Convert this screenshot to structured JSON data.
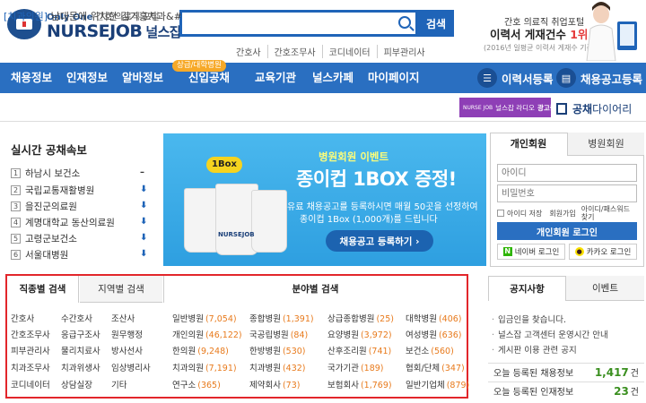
{
  "header": {
    "tagline_bold": "Only One",
    "tagline": "간호/의료직 포털",
    "brand": "NURSEJOB",
    "brand_kr": "널스잡",
    "search_placeholder": "",
    "search_button": "검색",
    "quick_links": [
      "간호사",
      "간호조무사",
      "코디네이터",
      "피부관리사"
    ],
    "ad_line1": "간호 의료직 취업포털",
    "ad_line2_prefix": "이력서 게재건수",
    "ad_line2_highlight": "1위",
    "ad_line3": "(2016년 일평균 이력서 게재수 기준)"
  },
  "nav": {
    "items": [
      "채용정보",
      "인재정보",
      "알바정보",
      "신입공채",
      "교육기관",
      "널스카페",
      "마이페이지"
    ],
    "badge": "상급/대학병원",
    "resume_button": "이력서등록",
    "job_post_button": "채용공고등록"
  },
  "notice_bar": {
    "tag": "[치과의원]",
    "text": "남대문에 위치한 김기홍치과&#",
    "radio_ad_small": "NURSE JOB",
    "radio_ad": "널스잡 라디오",
    "radio_ad_bold": "광고중",
    "diary_bold": "공채",
    "diary_rest": "다이어리"
  },
  "realtime": {
    "title": "실시간 공채속보",
    "items": [
      {
        "num": "1",
        "name": "하남시 보건소",
        "trend": "–"
      },
      {
        "num": "2",
        "name": "국립교통재활병원",
        "trend": "⬇"
      },
      {
        "num": "3",
        "name": "을진군의료원",
        "trend": "⬇"
      },
      {
        "num": "4",
        "name": "계명대학교 동산의료원",
        "trend": "⬇"
      },
      {
        "num": "5",
        "name": "고령군보건소",
        "trend": "⬇"
      },
      {
        "num": "6",
        "name": "서울대병원",
        "trend": "⬇"
      }
    ]
  },
  "banner": {
    "pill": "1Box",
    "cup_label": "NURSEJOB",
    "sub": "병원회원 이벤트",
    "main": "종이컵 1BOX 증정!",
    "desc1": "유료 채용공고를 등록하시면 매월 50곳을 선정하여",
    "desc2": "종이컵 1Box (1,000개)를 드립니다",
    "button": "채용공고 등록하기 ›"
  },
  "login": {
    "tab_personal": "개인회원",
    "tab_hospital": "병원회원",
    "id_placeholder": "아이디",
    "pw_placeholder": "비밀번호",
    "save_id": "아이디 저장",
    "join": "회원가입",
    "find": "아이디/패스워드",
    "find2": "찾기",
    "login_button": "개인회원 로그인",
    "naver": "네이버 로그인",
    "kakao": "카카오 로그인"
  },
  "categories": {
    "tab_job": "직종별 검색",
    "tab_region": "지역별 검색",
    "tab_field": "분야별 검색",
    "job_cols": [
      [
        "간호사",
        "간호조무사",
        "피부관리사",
        "치과조무사",
        "코디네이터"
      ],
      [
        "수간호사",
        "응급구조사",
        "물리치료사",
        "치과위생사",
        "상담실장"
      ],
      [
        "조산사",
        "원무행정",
        "방사선사",
        "임상병리사",
        "기타"
      ]
    ],
    "field_cols": [
      [
        [
          "일반병원",
          "(7,054)"
        ],
        [
          "개인의원",
          "(46,122)"
        ],
        [
          "한의원",
          "(9,248)"
        ],
        [
          "치과의원",
          "(7,191)"
        ],
        [
          "연구소",
          "(365)"
        ]
      ],
      [
        [
          "종합병원",
          "(1,391)"
        ],
        [
          "국공립병원",
          "(84)"
        ],
        [
          "한방병원",
          "(530)"
        ],
        [
          "치과병원",
          "(432)"
        ],
        [
          "제약회사",
          "(73)"
        ]
      ],
      [
        [
          "상급종합병원",
          "(25)"
        ],
        [
          "요양병원",
          "(3,972)"
        ],
        [
          "산후조리원",
          "(741)"
        ],
        [
          "국가기관",
          "(189)"
        ],
        [
          "보험회사",
          "(1,769)"
        ]
      ],
      [
        [
          "대학병원",
          "(406)"
        ],
        [
          "여성병원",
          "(636)"
        ],
        [
          "보건소",
          "(560)"
        ],
        [
          "협회/단체",
          "(347)"
        ],
        [
          "일반기업체",
          "(879)"
        ]
      ]
    ]
  },
  "notices": {
    "tab_notice": "공지사항",
    "tab_event": "이벤트",
    "items": [
      "입금인을 찾습니다.",
      "널스잡 고객센터 운영시간 안내",
      "게시판 이용 관련 공지"
    ],
    "stat1_label": "오늘 등록된 채용정보",
    "stat1_value": "1,417",
    "stat2_label": "오늘 등록된 인재정보",
    "stat2_value": "23",
    "unit": "건"
  },
  "colors": {
    "primary": "#2a6fc1",
    "brand": "#1a3f78",
    "highlight_border": "#e2262b",
    "count": "#e87a1c"
  }
}
